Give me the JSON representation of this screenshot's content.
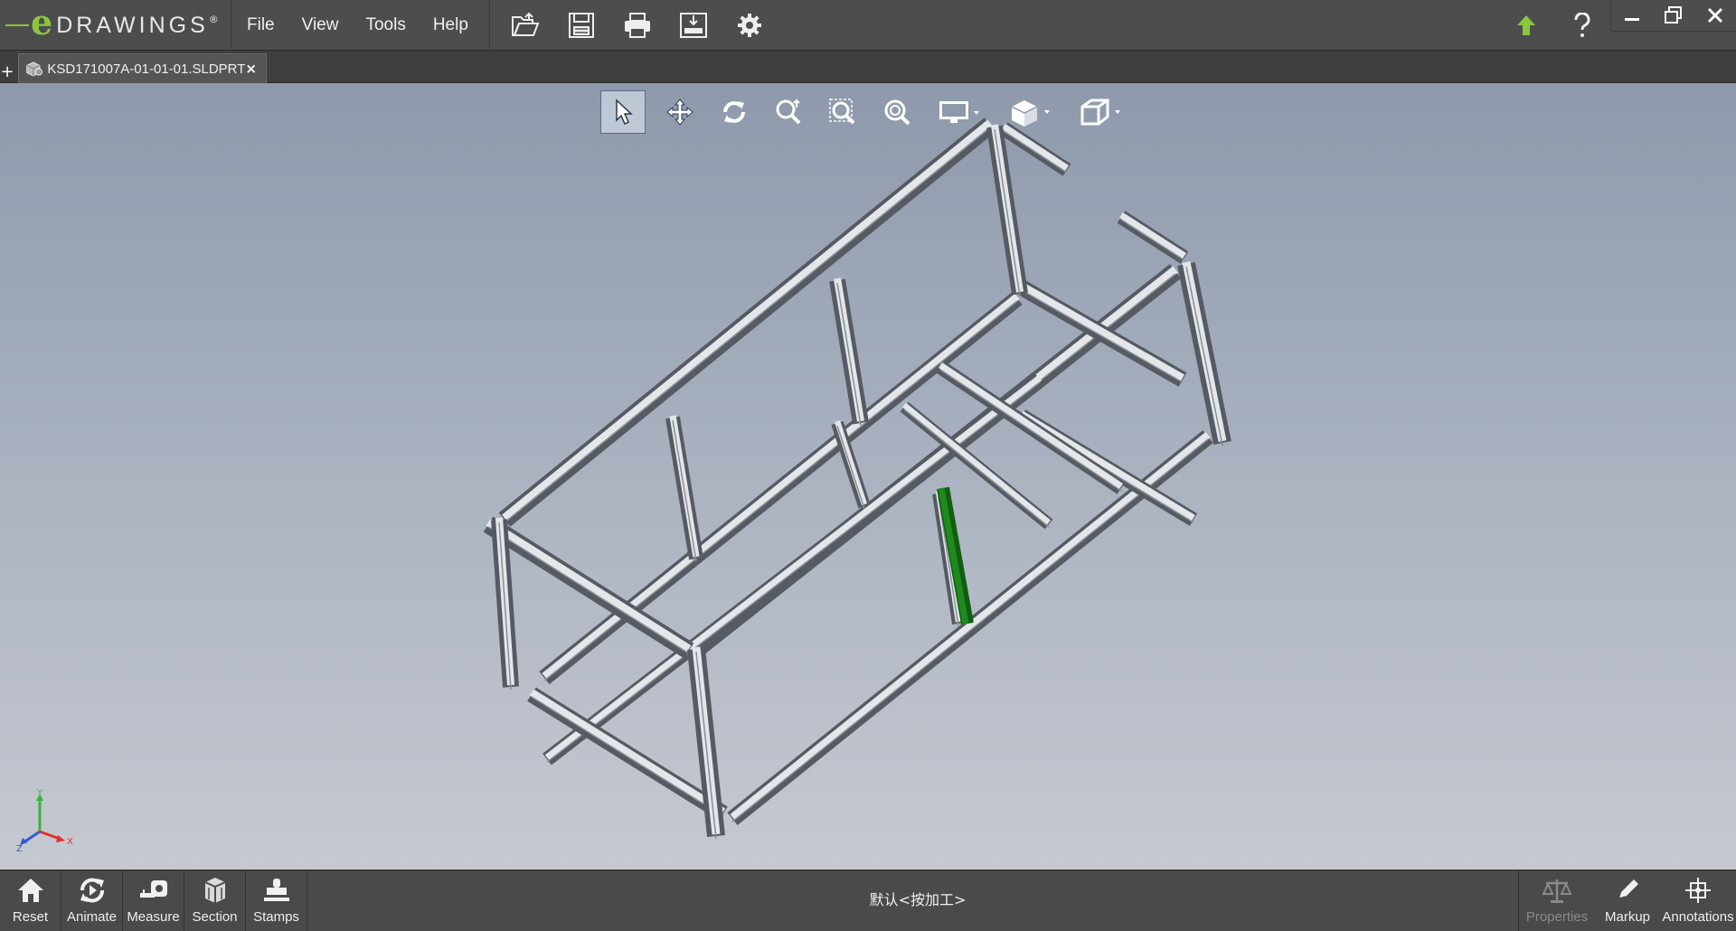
{
  "app": {
    "logo_letter": "e",
    "logo_text": "DRAWINGS",
    "logo_mark": "®"
  },
  "menu": {
    "items": [
      {
        "label": "File"
      },
      {
        "label": "View"
      },
      {
        "label": "Tools"
      },
      {
        "label": "Help"
      }
    ]
  },
  "toolbar": {
    "icons": [
      "open-icon",
      "save-icon",
      "print-icon",
      "publish-icon",
      "settings-icon"
    ]
  },
  "window": {
    "right_icons": [
      "update-icon",
      "help-icon"
    ],
    "controls": [
      "minimize-icon",
      "restore-icon",
      "close-icon"
    ]
  },
  "tabs": {
    "add": "+",
    "documents": [
      {
        "label": "KSD171007A-01-01-01.SLDPRT",
        "close": "×"
      }
    ]
  },
  "heads_up_toolbar": {
    "tools": [
      {
        "name": "select-tool",
        "active": true
      },
      {
        "name": "pan-tool"
      },
      {
        "name": "rotate-tool"
      },
      {
        "name": "zoom-tool"
      },
      {
        "name": "zoom-to-area-tool"
      },
      {
        "name": "zoom-to-fit-tool"
      },
      {
        "name": "display-style-tool",
        "dropdown": true
      },
      {
        "name": "view-orientation-tool",
        "dropdown": true
      },
      {
        "name": "section-view-tool",
        "dropdown": true
      }
    ]
  },
  "triad": {
    "x": "X",
    "y": "Y",
    "z": "Z"
  },
  "colors": {
    "accent_green": "#8cc63f",
    "selected_member": "#1f8a1f",
    "viewport_top": "#8e99ab",
    "viewport_bottom": "#c6c9d0",
    "frame_light": "#e4e6ea",
    "frame_dark": "#555a63"
  },
  "bottom_bar": {
    "left_buttons": [
      {
        "label": "Reset",
        "icon": "home-icon"
      },
      {
        "label": "Animate",
        "icon": "animate-icon"
      },
      {
        "label": "Measure",
        "icon": "measure-icon"
      },
      {
        "label": "Section",
        "icon": "section-icon"
      },
      {
        "label": "Stamps",
        "icon": "stamps-icon"
      }
    ],
    "status": "默认<按加工>",
    "right_buttons": [
      {
        "label": "Properties",
        "icon": "properties-icon",
        "enabled": false
      },
      {
        "label": "Markup",
        "icon": "pencil-icon",
        "enabled": true
      },
      {
        "label": "Annotations",
        "icon": "annotations-icon",
        "enabled": true
      }
    ]
  }
}
